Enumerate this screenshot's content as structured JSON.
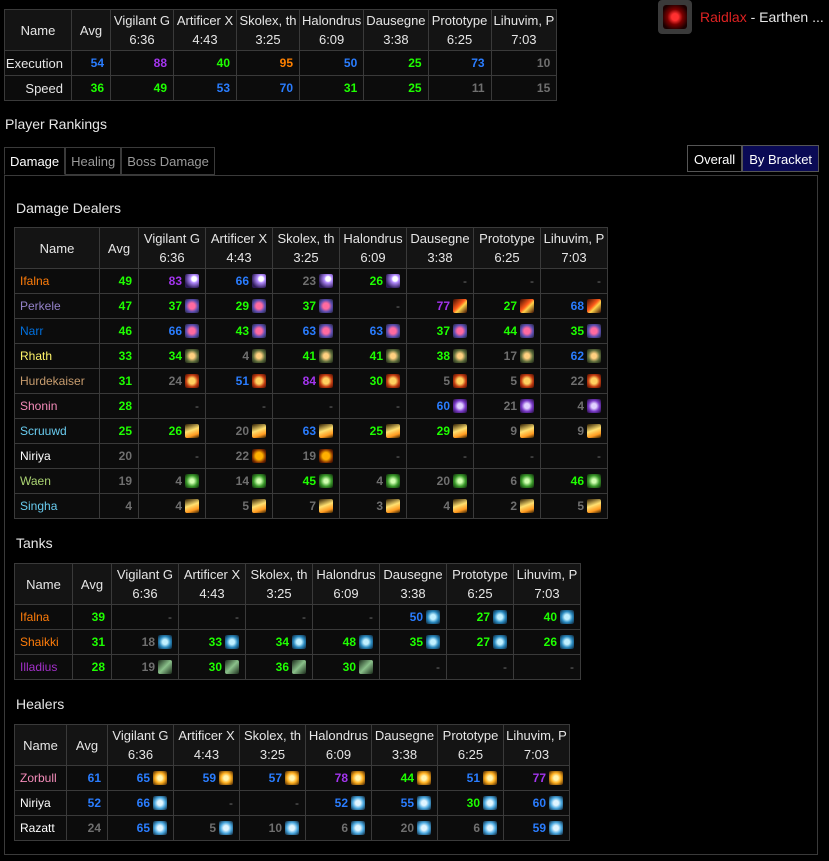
{
  "bosses": [
    {
      "name": "Vigilant G",
      "time": "6:36"
    },
    {
      "name": "Artificer X",
      "time": "4:43"
    },
    {
      "name": "Skolex, th",
      "time": "3:25"
    },
    {
      "name": "Halondrus",
      "time": "6:09"
    },
    {
      "name": "Dausegne",
      "time": "3:38"
    },
    {
      "name": "Prototype",
      "time": "6:25"
    },
    {
      "name": "Lihuvim, P",
      "time": "7:03"
    }
  ],
  "dmg_bosses": [
    {
      "name": "Vigilant G",
      "time": "6:36"
    },
    {
      "name": "Artificer X",
      "time": "4:43"
    },
    {
      "name": "Skolex, th",
      "time": "3:25"
    },
    {
      "name": "Halondrus",
      "time": "6:09"
    },
    {
      "name": "Dausegne",
      "time": "3:38"
    },
    {
      "name": "Prototype",
      "time": "6:25"
    },
    {
      "name": "Lihuvim, P",
      "time": "7:03"
    }
  ],
  "header": {
    "name_label": "Name",
    "avg_label": "Avg"
  },
  "summary": {
    "rows": [
      {
        "label": "Execution",
        "avg": {
          "v": "54",
          "c": "blue"
        },
        "cells": [
          {
            "v": "88",
            "c": "purple"
          },
          {
            "v": "40",
            "c": "green"
          },
          {
            "v": "95",
            "c": "orange"
          },
          {
            "v": "50",
            "c": "blue"
          },
          {
            "v": "25",
            "c": "green"
          },
          {
            "v": "73",
            "c": "blue"
          },
          {
            "v": "10",
            "c": "gray"
          }
        ]
      },
      {
        "label": "Speed",
        "avg": {
          "v": "36",
          "c": "green"
        },
        "cells": [
          {
            "v": "49",
            "c": "green"
          },
          {
            "v": "53",
            "c": "blue"
          },
          {
            "v": "70",
            "c": "blue"
          },
          {
            "v": "31",
            "c": "green"
          },
          {
            "v": "25",
            "c": "green"
          },
          {
            "v": "11",
            "c": "gray"
          },
          {
            "v": "15",
            "c": "gray"
          }
        ]
      }
    ]
  },
  "guild": {
    "name": "Raidlax",
    "realm": " - Earthen ..."
  },
  "rankings_title": "Player Rankings",
  "tabs": [
    "Damage",
    "Healing",
    "Boss Damage"
  ],
  "brackets": [
    "Overall",
    "By Bracket"
  ],
  "sections": {
    "damage": "Damage Dealers",
    "tanks": "Tanks",
    "healers": "Healers"
  },
  "damage": [
    {
      "name": "Ifalna",
      "cls": "orange",
      "avg": {
        "v": "49",
        "c": "green"
      },
      "cells": [
        {
          "v": "83",
          "c": "purple",
          "i": "arcane"
        },
        {
          "v": "66",
          "c": "blue",
          "i": "arcane"
        },
        {
          "v": "23",
          "c": "gray",
          "i": "arcane"
        },
        {
          "v": "26",
          "c": "green",
          "i": "arcane"
        },
        {
          "v": "-"
        },
        {
          "v": "-"
        },
        {
          "v": "-"
        }
      ]
    },
    {
      "name": "Perkele",
      "cls": "purple",
      "avg": {
        "v": "47",
        "c": "green"
      },
      "cells": [
        {
          "v": "37",
          "c": "green",
          "i": "cookie"
        },
        {
          "v": "29",
          "c": "green",
          "i": "cookie"
        },
        {
          "v": "37",
          "c": "green",
          "i": "cookie"
        },
        {
          "v": "-"
        },
        {
          "v": "77",
          "c": "purple",
          "i": "fire"
        },
        {
          "v": "27",
          "c": "green",
          "i": "fire"
        },
        {
          "v": "68",
          "c": "blue",
          "i": "fire"
        }
      ]
    },
    {
      "name": "Narr",
      "cls": "blue",
      "avg": {
        "v": "46",
        "c": "green"
      },
      "cells": [
        {
          "v": "66",
          "c": "blue",
          "i": "cookie"
        },
        {
          "v": "43",
          "c": "green",
          "i": "cookie"
        },
        {
          "v": "63",
          "c": "blue",
          "i": "cookie"
        },
        {
          "v": "63",
          "c": "blue",
          "i": "cookie"
        },
        {
          "v": "37",
          "c": "green",
          "i": "cookie"
        },
        {
          "v": "44",
          "c": "green",
          "i": "cookie"
        },
        {
          "v": "35",
          "c": "green",
          "i": "cookie"
        }
      ]
    },
    {
      "name": "Rhath",
      "cls": "yellow",
      "avg": {
        "v": "33",
        "c": "green"
      },
      "cells": [
        {
          "v": "34",
          "c": "green",
          "i": "storm"
        },
        {
          "v": "4",
          "c": "gray",
          "i": "storm"
        },
        {
          "v": "41",
          "c": "green",
          "i": "storm"
        },
        {
          "v": "41",
          "c": "green",
          "i": "storm"
        },
        {
          "v": "38",
          "c": "green",
          "i": "storm"
        },
        {
          "v": "17",
          "c": "gray",
          "i": "storm"
        },
        {
          "v": "62",
          "c": "blue",
          "i": "storm"
        }
      ]
    },
    {
      "name": "Hurdekaiser",
      "cls": "tan",
      "avg": {
        "v": "31",
        "c": "green"
      },
      "cells": [
        {
          "v": "24",
          "c": "gray",
          "i": "mask"
        },
        {
          "v": "51",
          "c": "blue",
          "i": "mask"
        },
        {
          "v": "84",
          "c": "purple",
          "i": "mask"
        },
        {
          "v": "30",
          "c": "green",
          "i": "mask"
        },
        {
          "v": "5",
          "c": "gray",
          "i": "mask"
        },
        {
          "v": "5",
          "c": "gray",
          "i": "mask"
        },
        {
          "v": "22",
          "c": "gray",
          "i": "mask"
        }
      ]
    },
    {
      "name": "Shonin",
      "cls": "pink",
      "avg": {
        "v": "28",
        "c": "green"
      },
      "cells": [
        {
          "v": "-"
        },
        {
          "v": "-"
        },
        {
          "v": "-"
        },
        {
          "v": "-"
        },
        {
          "v": "60",
          "c": "blue",
          "i": "shadow"
        },
        {
          "v": "21",
          "c": "gray",
          "i": "shadow"
        },
        {
          "v": "4",
          "c": "gray",
          "i": "shadow"
        }
      ]
    },
    {
      "name": "Scruuwd",
      "cls": "cyan",
      "avg": {
        "v": "25",
        "c": "green"
      },
      "cells": [
        {
          "v": "26",
          "c": "green",
          "i": "holy"
        },
        {
          "v": "20",
          "c": "gray",
          "i": "holy"
        },
        {
          "v": "63",
          "c": "blue",
          "i": "holy"
        },
        {
          "v": "25",
          "c": "green",
          "i": "holy"
        },
        {
          "v": "29",
          "c": "green",
          "i": "holy"
        },
        {
          "v": "9",
          "c": "gray",
          "i": "holy"
        },
        {
          "v": "9",
          "c": "gray",
          "i": "holy"
        }
      ]
    },
    {
      "name": "Niriya",
      "cls": "white",
      "avg": {
        "v": "20",
        "c": "gray"
      },
      "cells": [
        {
          "v": "-"
        },
        {
          "v": "22",
          "c": "gray",
          "i": "moon"
        },
        {
          "v": "19",
          "c": "gray",
          "i": "moon"
        },
        {
          "v": "-"
        },
        {
          "v": "-"
        },
        {
          "v": "-"
        },
        {
          "v": "-"
        }
      ]
    },
    {
      "name": "Waen",
      "cls": "green",
      "avg": {
        "v": "19",
        "c": "gray"
      },
      "cells": [
        {
          "v": "4",
          "c": "gray",
          "i": "beast"
        },
        {
          "v": "14",
          "c": "gray",
          "i": "beast"
        },
        {
          "v": "45",
          "c": "green",
          "i": "beast"
        },
        {
          "v": "4",
          "c": "gray",
          "i": "beast"
        },
        {
          "v": "20",
          "c": "gray",
          "i": "beast"
        },
        {
          "v": "6",
          "c": "gray",
          "i": "beast"
        },
        {
          "v": "46",
          "c": "green",
          "i": "beast"
        }
      ]
    },
    {
      "name": "Singha",
      "cls": "cyan",
      "avg": {
        "v": "4",
        "c": "gray"
      },
      "cells": [
        {
          "v": "4",
          "c": "gray",
          "i": "holy"
        },
        {
          "v": "5",
          "c": "gray",
          "i": "holy"
        },
        {
          "v": "7",
          "c": "gray",
          "i": "holy"
        },
        {
          "v": "3",
          "c": "gray",
          "i": "holy"
        },
        {
          "v": "4",
          "c": "gray",
          "i": "holy"
        },
        {
          "v": "2",
          "c": "gray",
          "i": "holy"
        },
        {
          "v": "5",
          "c": "gray",
          "i": "holy"
        }
      ]
    }
  ],
  "tanks": [
    {
      "name": "Ifalna",
      "cls": "orange",
      "avg": {
        "v": "39",
        "c": "green"
      },
      "cells": [
        {
          "v": "-"
        },
        {
          "v": "-"
        },
        {
          "v": "-"
        },
        {
          "v": "-"
        },
        {
          "v": "50",
          "c": "blue",
          "i": "shield"
        },
        {
          "v": "27",
          "c": "green",
          "i": "shield"
        },
        {
          "v": "40",
          "c": "green",
          "i": "shield"
        }
      ]
    },
    {
      "name": "Shaikki",
      "cls": "orange",
      "avg": {
        "v": "31",
        "c": "green"
      },
      "cells": [
        {
          "v": "18",
          "c": "gray",
          "i": "shield"
        },
        {
          "v": "33",
          "c": "green",
          "i": "shield"
        },
        {
          "v": "34",
          "c": "green",
          "i": "shield"
        },
        {
          "v": "48",
          "c": "green",
          "i": "shield"
        },
        {
          "v": "35",
          "c": "green",
          "i": "shield"
        },
        {
          "v": "27",
          "c": "green",
          "i": "shield"
        },
        {
          "v": "26",
          "c": "green",
          "i": "shield"
        }
      ]
    },
    {
      "name": "Illadius",
      "cls": "violet",
      "avg": {
        "v": "28",
        "c": "green"
      },
      "cells": [
        {
          "v": "19",
          "c": "gray",
          "i": "mech"
        },
        {
          "v": "30",
          "c": "green",
          "i": "mech"
        },
        {
          "v": "36",
          "c": "green",
          "i": "mech"
        },
        {
          "v": "30",
          "c": "green",
          "i": "mech"
        },
        {
          "v": "-"
        },
        {
          "v": "-"
        },
        {
          "v": "-"
        }
      ]
    }
  ],
  "healers": [
    {
      "name": "Zorbull",
      "cls": "pink",
      "avg": {
        "v": "61",
        "c": "blue"
      },
      "cells": [
        {
          "v": "65",
          "c": "blue",
          "i": "star"
        },
        {
          "v": "59",
          "c": "blue",
          "i": "star"
        },
        {
          "v": "57",
          "c": "blue",
          "i": "star"
        },
        {
          "v": "78",
          "c": "purple",
          "i": "star"
        },
        {
          "v": "44",
          "c": "green",
          "i": "star"
        },
        {
          "v": "51",
          "c": "blue",
          "i": "star"
        },
        {
          "v": "77",
          "c": "purple",
          "i": "star"
        }
      ]
    },
    {
      "name": "Niriya",
      "cls": "white",
      "avg": {
        "v": "52",
        "c": "blue"
      },
      "cells": [
        {
          "v": "66",
          "c": "blue",
          "i": "spirit"
        },
        {
          "v": "-"
        },
        {
          "v": "-"
        },
        {
          "v": "52",
          "c": "blue",
          "i": "spirit"
        },
        {
          "v": "55",
          "c": "blue",
          "i": "spirit"
        },
        {
          "v": "30",
          "c": "green",
          "i": "spirit"
        },
        {
          "v": "60",
          "c": "blue",
          "i": "spirit"
        }
      ]
    },
    {
      "name": "Razatt",
      "cls": "white",
      "avg": {
        "v": "24",
        "c": "gray"
      },
      "cells": [
        {
          "v": "65",
          "c": "blue",
          "i": "spirit"
        },
        {
          "v": "5",
          "c": "gray",
          "i": "spirit"
        },
        {
          "v": "10",
          "c": "gray",
          "i": "spirit"
        },
        {
          "v": "6",
          "c": "gray",
          "i": "spirit"
        },
        {
          "v": "20",
          "c": "gray",
          "i": "spirit"
        },
        {
          "v": "6",
          "c": "gray",
          "i": "spirit"
        },
        {
          "v": "59",
          "c": "blue",
          "i": "spirit"
        }
      ]
    }
  ]
}
